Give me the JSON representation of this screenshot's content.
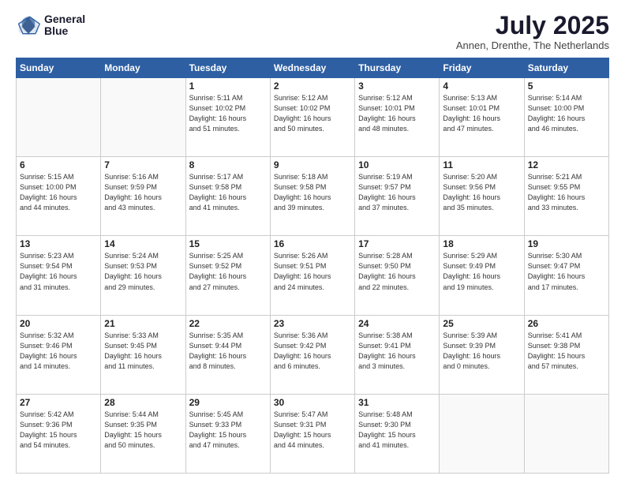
{
  "header": {
    "logo_line1": "General",
    "logo_line2": "Blue",
    "month_title": "July 2025",
    "location": "Annen, Drenthe, The Netherlands"
  },
  "weekdays": [
    "Sunday",
    "Monday",
    "Tuesday",
    "Wednesday",
    "Thursday",
    "Friday",
    "Saturday"
  ],
  "weeks": [
    [
      {
        "day": "",
        "info": ""
      },
      {
        "day": "",
        "info": ""
      },
      {
        "day": "1",
        "info": "Sunrise: 5:11 AM\nSunset: 10:02 PM\nDaylight: 16 hours\nand 51 minutes."
      },
      {
        "day": "2",
        "info": "Sunrise: 5:12 AM\nSunset: 10:02 PM\nDaylight: 16 hours\nand 50 minutes."
      },
      {
        "day": "3",
        "info": "Sunrise: 5:12 AM\nSunset: 10:01 PM\nDaylight: 16 hours\nand 48 minutes."
      },
      {
        "day": "4",
        "info": "Sunrise: 5:13 AM\nSunset: 10:01 PM\nDaylight: 16 hours\nand 47 minutes."
      },
      {
        "day": "5",
        "info": "Sunrise: 5:14 AM\nSunset: 10:00 PM\nDaylight: 16 hours\nand 46 minutes."
      }
    ],
    [
      {
        "day": "6",
        "info": "Sunrise: 5:15 AM\nSunset: 10:00 PM\nDaylight: 16 hours\nand 44 minutes."
      },
      {
        "day": "7",
        "info": "Sunrise: 5:16 AM\nSunset: 9:59 PM\nDaylight: 16 hours\nand 43 minutes."
      },
      {
        "day": "8",
        "info": "Sunrise: 5:17 AM\nSunset: 9:58 PM\nDaylight: 16 hours\nand 41 minutes."
      },
      {
        "day": "9",
        "info": "Sunrise: 5:18 AM\nSunset: 9:58 PM\nDaylight: 16 hours\nand 39 minutes."
      },
      {
        "day": "10",
        "info": "Sunrise: 5:19 AM\nSunset: 9:57 PM\nDaylight: 16 hours\nand 37 minutes."
      },
      {
        "day": "11",
        "info": "Sunrise: 5:20 AM\nSunset: 9:56 PM\nDaylight: 16 hours\nand 35 minutes."
      },
      {
        "day": "12",
        "info": "Sunrise: 5:21 AM\nSunset: 9:55 PM\nDaylight: 16 hours\nand 33 minutes."
      }
    ],
    [
      {
        "day": "13",
        "info": "Sunrise: 5:23 AM\nSunset: 9:54 PM\nDaylight: 16 hours\nand 31 minutes."
      },
      {
        "day": "14",
        "info": "Sunrise: 5:24 AM\nSunset: 9:53 PM\nDaylight: 16 hours\nand 29 minutes."
      },
      {
        "day": "15",
        "info": "Sunrise: 5:25 AM\nSunset: 9:52 PM\nDaylight: 16 hours\nand 27 minutes."
      },
      {
        "day": "16",
        "info": "Sunrise: 5:26 AM\nSunset: 9:51 PM\nDaylight: 16 hours\nand 24 minutes."
      },
      {
        "day": "17",
        "info": "Sunrise: 5:28 AM\nSunset: 9:50 PM\nDaylight: 16 hours\nand 22 minutes."
      },
      {
        "day": "18",
        "info": "Sunrise: 5:29 AM\nSunset: 9:49 PM\nDaylight: 16 hours\nand 19 minutes."
      },
      {
        "day": "19",
        "info": "Sunrise: 5:30 AM\nSunset: 9:47 PM\nDaylight: 16 hours\nand 17 minutes."
      }
    ],
    [
      {
        "day": "20",
        "info": "Sunrise: 5:32 AM\nSunset: 9:46 PM\nDaylight: 16 hours\nand 14 minutes."
      },
      {
        "day": "21",
        "info": "Sunrise: 5:33 AM\nSunset: 9:45 PM\nDaylight: 16 hours\nand 11 minutes."
      },
      {
        "day": "22",
        "info": "Sunrise: 5:35 AM\nSunset: 9:44 PM\nDaylight: 16 hours\nand 8 minutes."
      },
      {
        "day": "23",
        "info": "Sunrise: 5:36 AM\nSunset: 9:42 PM\nDaylight: 16 hours\nand 6 minutes."
      },
      {
        "day": "24",
        "info": "Sunrise: 5:38 AM\nSunset: 9:41 PM\nDaylight: 16 hours\nand 3 minutes."
      },
      {
        "day": "25",
        "info": "Sunrise: 5:39 AM\nSunset: 9:39 PM\nDaylight: 16 hours\nand 0 minutes."
      },
      {
        "day": "26",
        "info": "Sunrise: 5:41 AM\nSunset: 9:38 PM\nDaylight: 15 hours\nand 57 minutes."
      }
    ],
    [
      {
        "day": "27",
        "info": "Sunrise: 5:42 AM\nSunset: 9:36 PM\nDaylight: 15 hours\nand 54 minutes."
      },
      {
        "day": "28",
        "info": "Sunrise: 5:44 AM\nSunset: 9:35 PM\nDaylight: 15 hours\nand 50 minutes."
      },
      {
        "day": "29",
        "info": "Sunrise: 5:45 AM\nSunset: 9:33 PM\nDaylight: 15 hours\nand 47 minutes."
      },
      {
        "day": "30",
        "info": "Sunrise: 5:47 AM\nSunset: 9:31 PM\nDaylight: 15 hours\nand 44 minutes."
      },
      {
        "day": "31",
        "info": "Sunrise: 5:48 AM\nSunset: 9:30 PM\nDaylight: 15 hours\nand 41 minutes."
      },
      {
        "day": "",
        "info": ""
      },
      {
        "day": "",
        "info": ""
      }
    ]
  ]
}
